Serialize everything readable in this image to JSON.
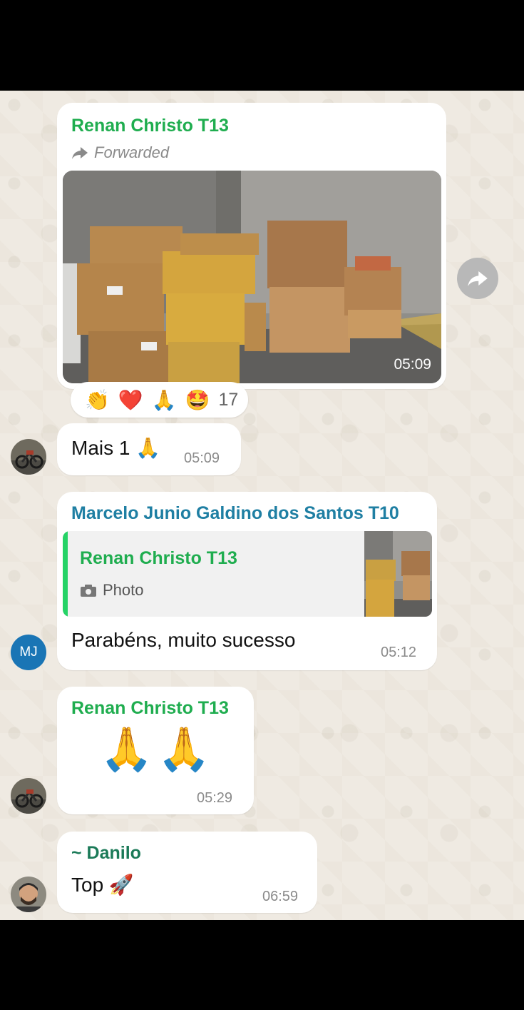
{
  "messages": [
    {
      "sender": "Renan Christo T13",
      "forwarded_label": "Forwarded",
      "media": "photo of stacked cardboard boxes wrapped in yellow tape",
      "time": "05:09",
      "reactions": {
        "emojis": [
          "👏",
          "❤️",
          "🙏",
          "🤩"
        ],
        "count": "17"
      }
    },
    {
      "text": "Mais 1 🙏",
      "time": "05:09"
    },
    {
      "sender": "Marcelo Junio Galdino dos Santos T10",
      "avatar_initials": "MJ",
      "quote": {
        "sender": "Renan Christo T13",
        "type_label": "Photo"
      },
      "text": "Parabéns, muito sucesso",
      "time": "05:12"
    },
    {
      "sender": "Renan Christo T13",
      "text": "🙏🙏",
      "time": "05:29"
    },
    {
      "sender": "~ Danilo",
      "text": "Top 🚀",
      "time": "06:59"
    }
  ],
  "colors": {
    "renan_name": "#1fad4f",
    "marcelo_name": "#1f7fa3",
    "danilo_name": "#1b7a58",
    "quote_bar": "#25d366",
    "mj_avatar": "#1a75b5",
    "forward_button": "#b8b8b8"
  },
  "icons": [
    "forward-icon",
    "camera-icon",
    "share-forward-icon"
  ]
}
